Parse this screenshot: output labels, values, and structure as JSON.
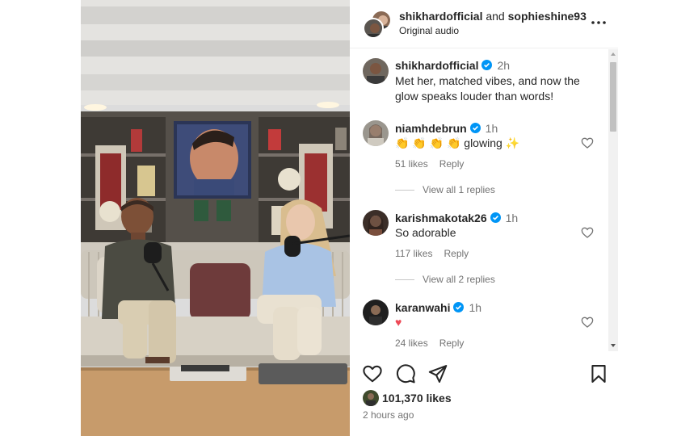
{
  "header": {
    "user1": "shikhardofficial",
    "joiner": "and",
    "user2": "sophieshine93",
    "audio": "Original audio",
    "more_icon": "more-horizontal-icon"
  },
  "caption": {
    "username": "shikhardofficial",
    "time": "2h",
    "text": "Met her, matched vibes, and now the glow speaks louder than words!"
  },
  "comments": [
    {
      "username": "niamhdebrun",
      "time": "1h",
      "text": "👏 👏 👏 👏 glowing ✨",
      "likes": "51 likes",
      "reply": "Reply",
      "view_replies": "View all 1 replies"
    },
    {
      "username": "karishmakotak26",
      "time": "1h",
      "text": "So adorable",
      "likes": "117 likes",
      "reply": "Reply",
      "view_replies": "View all 2 replies"
    },
    {
      "username": "karanwahi",
      "time": "1h",
      "text": "♥",
      "likes": "24 likes",
      "reply": "Reply"
    }
  ],
  "actions": {
    "like_icon": "heart-icon",
    "comment_icon": "comment-icon",
    "share_icon": "send-icon",
    "save_icon": "bookmark-icon"
  },
  "likes_count": "101,370 likes",
  "posted": "2 hours ago",
  "colors": {
    "verified": "#0095f6",
    "text": "#262626",
    "secondary": "#737373",
    "heart_red": "#ed4956"
  }
}
